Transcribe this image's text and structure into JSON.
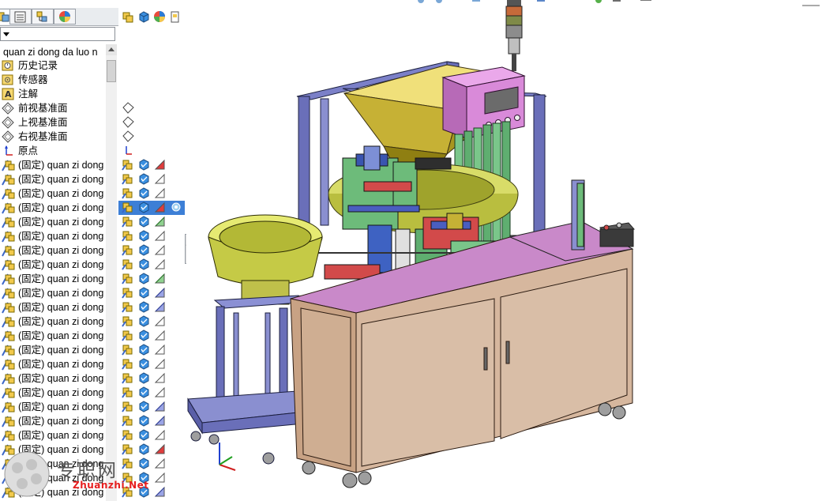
{
  "feature_tree": {
    "root_label": "quan zi dong da luo n",
    "items": [
      {
        "icon": "history-icon",
        "label": "历史记录",
        "kind": "folder"
      },
      {
        "icon": "sensor-icon",
        "label": "传感器",
        "kind": "folder"
      },
      {
        "icon": "annotation-icon",
        "label": "注解",
        "kind": "folder"
      },
      {
        "icon": "plane-icon",
        "label": "前视基准面",
        "kind": "plane"
      },
      {
        "icon": "plane-icon",
        "label": "上视基准面",
        "kind": "plane"
      },
      {
        "icon": "plane-icon",
        "label": "右视基准面",
        "kind": "plane"
      },
      {
        "icon": "origin-icon",
        "label": "原点",
        "kind": "origin"
      },
      {
        "icon": "component-icon",
        "label": "(固定) quan zi dong",
        "kind": "part"
      },
      {
        "icon": "component-icon",
        "label": "(固定) quan zi dong",
        "kind": "part"
      },
      {
        "icon": "component-icon",
        "label": "(固定) quan zi dong",
        "kind": "part"
      },
      {
        "icon": "component-icon",
        "label": "(固定) quan zi dong",
        "kind": "part",
        "selected": true
      },
      {
        "icon": "component-icon",
        "label": "(固定) quan zi dong",
        "kind": "part"
      },
      {
        "icon": "component-icon",
        "label": "(固定) quan zi dong",
        "kind": "part"
      },
      {
        "icon": "component-icon",
        "label": "(固定) quan zi dong",
        "kind": "part"
      },
      {
        "icon": "component-icon",
        "label": "(固定) quan zi dong",
        "kind": "part"
      },
      {
        "icon": "component-icon",
        "label": "(固定) quan zi dong",
        "kind": "part"
      },
      {
        "icon": "component-icon",
        "label": "(固定) quan zi dong",
        "kind": "part"
      },
      {
        "icon": "component-icon",
        "label": "(固定) quan zi dong",
        "kind": "part"
      },
      {
        "icon": "component-icon",
        "label": "(固定) quan zi dong",
        "kind": "part"
      },
      {
        "icon": "component-icon",
        "label": "(固定) quan zi dong",
        "kind": "part"
      },
      {
        "icon": "component-icon",
        "label": "(固定) quan zi dong",
        "kind": "part"
      },
      {
        "icon": "component-icon",
        "label": "(固定) quan zi dong",
        "kind": "part"
      },
      {
        "icon": "component-icon",
        "label": "(固定) quan zi dong",
        "kind": "part"
      },
      {
        "icon": "component-icon",
        "label": "(固定) quan zi dong",
        "kind": "part"
      },
      {
        "icon": "component-icon",
        "label": "(固定) quan zi dong",
        "kind": "part"
      },
      {
        "icon": "component-icon",
        "label": "(固定) quan zi dong",
        "kind": "part"
      },
      {
        "icon": "component-icon",
        "label": "(固定) quan zi dong",
        "kind": "part"
      },
      {
        "icon": "component-icon",
        "label": "(固定) quan zi dong",
        "kind": "part"
      },
      {
        "icon": "component-icon",
        "label": "(固定) quan zi dong",
        "kind": "part"
      },
      {
        "icon": "component-icon",
        "label": "(固定) quan zi dong",
        "kind": "part"
      },
      {
        "icon": "component-icon",
        "label": "(固定) quan zi dong",
        "kind": "part"
      }
    ],
    "state_icons": [
      "red-x-icon",
      "plain",
      "plain",
      "red-x-icon",
      "green",
      "plain",
      "plain",
      "plain",
      "green",
      "blue",
      "blue",
      "plain",
      "plain",
      "plain",
      "plain",
      "plain",
      "plain",
      "blue",
      "blue",
      "plain",
      "red-x-icon",
      "plain",
      "plain",
      "blue"
    ]
  },
  "colors": {
    "selection": "#3d7fd6",
    "cabinet": "#d6b79e",
    "cabinet_top": "#c989c9",
    "frame": "#5a5fa8",
    "hopper": "#c8b33c",
    "bowl": "#cdd25a",
    "control_box": "#d98ad9",
    "mechanism_green": "#6dbb7a",
    "mechanism_red": "#d24a4a"
  },
  "watermark": {
    "text": "专职网",
    "url": "Zhuanzhi.Net"
  }
}
